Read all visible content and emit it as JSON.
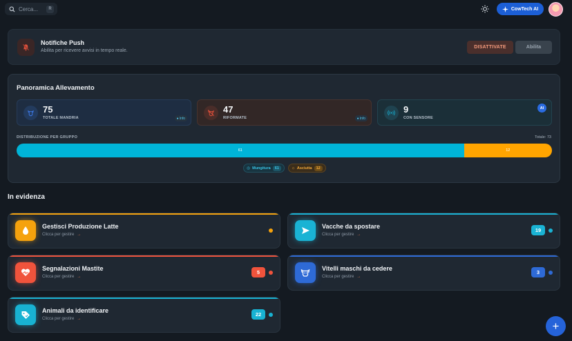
{
  "header": {
    "search_placeholder": "Cerca...",
    "search_shortcut": "R",
    "ai_button": "CowTech AI"
  },
  "notification": {
    "title": "Notifiche Push",
    "subtitle": "Abilita per ricevere avvisi in tempo reale.",
    "status_button": "DISATTIVATE",
    "enable_button": "Abilita"
  },
  "overview": {
    "title": "Panoramica Allevamento",
    "stats": [
      {
        "value": "75",
        "label": "TOTALE MANDRIA",
        "info": "Info",
        "color": "#2f6bd8"
      },
      {
        "value": "47",
        "label": "RIFORMATE",
        "info": "Info",
        "color": "#e2503b"
      },
      {
        "value": "9",
        "label": "CON SENSORE",
        "badge": "AI",
        "color": "#18a8c9"
      }
    ],
    "distribution": {
      "label": "DISTRIBUZIONE PER GRUPPO",
      "total": "Totale: 73",
      "segments": [
        {
          "name": "Mungitura",
          "value": 61,
          "color": "#00b4d8"
        },
        {
          "name": "Asciutta",
          "value": 12,
          "color": "#ffa500"
        }
      ]
    }
  },
  "featured": {
    "title": "In evidenza",
    "cards": [
      {
        "title": "Gestisci Produzione Latte",
        "subtitle": "Clicca per gestire",
        "count": null,
        "color": "#f5a20d",
        "icon": "milk-drop-icon"
      },
      {
        "title": "Vacche da spostare",
        "subtitle": "Clicca per gestire",
        "count": "19",
        "color": "#1ab3d4",
        "icon": "send-arrow-icon"
      },
      {
        "title": "Segnalazioni Mastite",
        "subtitle": "Clicca per gestire",
        "count": "5",
        "color": "#f0533c",
        "icon": "heart-pulse-icon"
      },
      {
        "title": "Vitelli maschi da cedere",
        "subtitle": "Clicca per gestire",
        "count": "3",
        "color": "#2e6ad6",
        "icon": "cow-icon"
      },
      {
        "title": "Animali da identificare",
        "subtitle": "Clicca per gestire",
        "count": "22",
        "color": "#18b2d2",
        "icon": "tag-icon"
      }
    ]
  },
  "fab_label": "+"
}
